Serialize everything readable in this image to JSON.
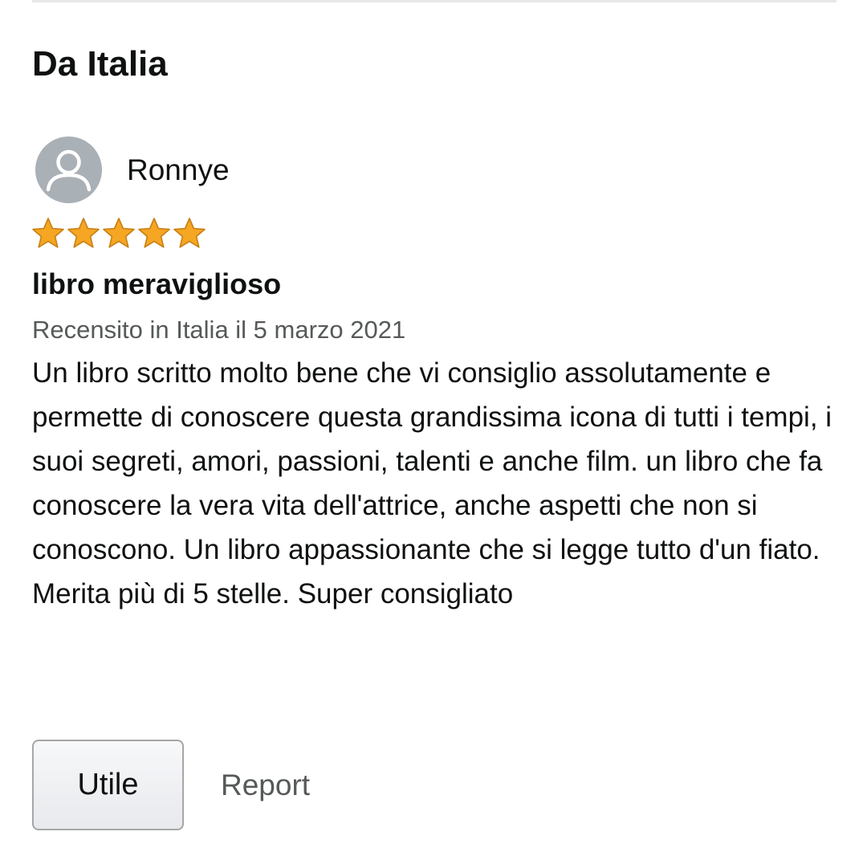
{
  "section": {
    "title": "Da Italia"
  },
  "review": {
    "author": "Ronnye",
    "rating": 5,
    "rating_max": 5,
    "star_color": "#f5a623",
    "title": "libro meraviglioso",
    "date": "Recensito in Italia il 5 marzo 2021",
    "body": "Un libro scritto molto bene che vi consiglio assolutamente e permette di conoscere questa grandissima icona di tutti i tempi, i suoi segreti, amori, passioni, talenti e anche film. un libro che fa conoscere la vera vita dell'attrice, anche aspetti che non si conoscono. Un libro appassionante che si legge tutto d'un fiato. Merita più di 5 stelle. Super consigliato"
  },
  "actions": {
    "helpful_label": "Utile",
    "report_label": "Report"
  }
}
